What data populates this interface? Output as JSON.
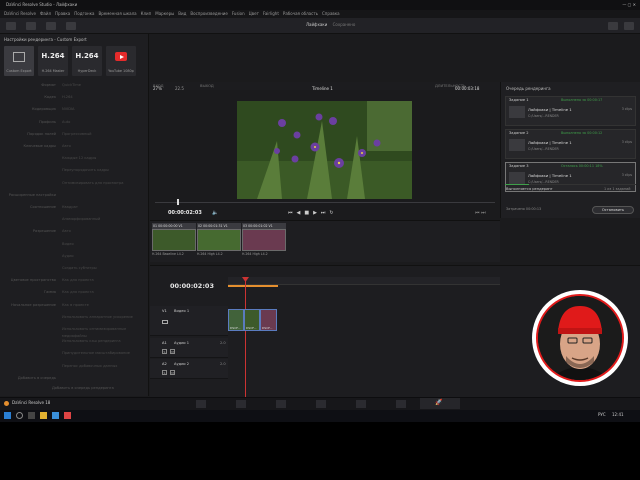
{
  "window": {
    "title": "DaVinci Resolve Studio - Лайфхаки"
  },
  "menu": [
    "DaVinci Resolve",
    "Файл",
    "Правка",
    "Подгонка",
    "Временная шкала",
    "Клип",
    "Маркеры",
    "Вид",
    "Воспроизведение",
    "Fusion",
    "Цвет",
    "Fairlight",
    "Рабочая область",
    "Справка"
  ],
  "project": {
    "name": "Лайфхаки",
    "status": "Сохранено"
  },
  "left_panel": {
    "title": "Настройки рендеринга - Custom Export",
    "presets": [
      {
        "big": "",
        "small": "Custom Export"
      },
      {
        "big": "H.264",
        "small": "H.264 Master"
      },
      {
        "big": "H.264",
        "small": "HyperDeck"
      },
      {
        "big": "",
        "small": "YouTube 1080p"
      }
    ],
    "fields": [
      {
        "label": "Формат",
        "value": "QuickTime"
      },
      {
        "label": "Кодек",
        "value": "H.264"
      },
      {
        "label": "Кодировщик",
        "value": "NVIDIA"
      },
      {
        "label": "Профиль",
        "value": "Auto"
      },
      {
        "label": "Порядок полей",
        "value": "Прогрессивный"
      },
      {
        "label": "Ключевые кадры",
        "value": "Авто"
      },
      {
        "label": "",
        "value": "Каждые  12 кадры"
      },
      {
        "label": "",
        "value": "Переупорядочить кадры"
      },
      {
        "label": "",
        "value": "Оптимизировать для просмотра"
      },
      {
        "label": "Расширенные настройки",
        "value": ""
      },
      {
        "label": "Соотношение",
        "value": "Квадрат"
      },
      {
        "label": "",
        "value": "Анаморфированный"
      },
      {
        "label": "Разрешение",
        "value": "Авто"
      },
      {
        "label": "",
        "value": "Видео"
      },
      {
        "label": "",
        "value": "Аудио"
      },
      {
        "label": "",
        "value": "Создать субтитры"
      },
      {
        "label": "Цветовое пространство",
        "value": "Как для проекта"
      },
      {
        "label": "Гамма",
        "value": "Как для проекта"
      },
      {
        "label": "Начальное разрешение",
        "value": "Как в проекте"
      },
      {
        "label": "",
        "value": "Использовать аппаратное ускорение"
      },
      {
        "label": "",
        "value": "Использовать оптимизированные медиафайлы"
      },
      {
        "label": "",
        "value": "Использовать кэш рендеринга"
      },
      {
        "label": "",
        "value": "Принудительное масштабирование"
      },
      {
        "label": "",
        "value": "Перенос добавочных данных"
      },
      {
        "label": "Добавить в очередь",
        "value": ""
      }
    ],
    "add_button": "Добавить в очередь рендеринга"
  },
  "viewer": {
    "zoom": "27%",
    "fps": "22.5",
    "timeline_name": "Timeline 1",
    "timecode_top": "00:00:03:18",
    "in_label": "ВХОД",
    "out_label": "ВЫХОД",
    "duration_label": "ДЛИТЕЛЬНОСТЬ",
    "timecode": "00:00:02:03"
  },
  "clips": [
    {
      "num": "01",
      "tc": "00:00:00:00",
      "v": "V1",
      "name": "H.264 Baseline L4.2"
    },
    {
      "num": "02",
      "tc": "00:00:01:31",
      "v": "V1",
      "name": "H.264 High L4.2"
    },
    {
      "num": "03",
      "tc": "00:00:01:02",
      "v": "V1",
      "name": "H.264 High L4.2"
    }
  ],
  "timeline": {
    "timecode": "00:00:02:03",
    "tracks": [
      {
        "id": "V1",
        "name": "Видео 1",
        "clips_label": "3 клипы"
      },
      {
        "id": "A1",
        "name": "Аудио 1",
        "level": "2.0"
      },
      {
        "id": "A2",
        "name": "Аудио 2",
        "level": "2.0"
      }
    ],
    "clip_labels": [
      "DSCF...",
      "DSCF...",
      "DSCF..."
    ]
  },
  "render_queue": {
    "title": "Очередь рендеринга",
    "jobs": [
      {
        "name": "Задание 1",
        "status": "Выполнено за 00:00:17",
        "title": "Лайфхаки | Timeline 1",
        "path": "C:/Users/...RENDER",
        "dur": "3 clips"
      },
      {
        "name": "Задание 2",
        "status": "Выполнено за 00:00:12",
        "title": "Лайфхаки | Timeline 1",
        "path": "C:/Users/...RENDER",
        "dur": "3 clips"
      },
      {
        "name": "Задание 3",
        "status": "Осталось 00:00:11  18%",
        "title": "Лайфхаки | Timeline 1",
        "path": "C:/Users/...RENDER",
        "dur": "3 clips"
      }
    ],
    "progress": 0.18,
    "info": "Выполняется рендеринг",
    "count": "1 из 1 заданий",
    "remaining": "Затрачено 00:00:13",
    "stop_button": "Остановить"
  },
  "bottom": {
    "app": "DaVinci Resolve 18"
  },
  "taskbar": {
    "lang": "РУС",
    "time": "12:41"
  },
  "colors": {
    "accent": "#e58f2f",
    "playhead": "#cc3333",
    "green": "#3fa04a",
    "clip": "#5a7bbf",
    "youtube": "#e52b2b"
  }
}
